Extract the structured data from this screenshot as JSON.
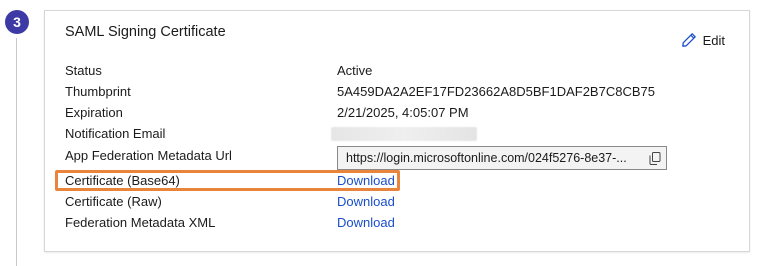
{
  "step": {
    "number": "3"
  },
  "card": {
    "title": "SAML Signing Certificate",
    "edit_label": "Edit"
  },
  "fields": [
    {
      "label": "Status",
      "value": "Active"
    },
    {
      "label": "Thumbprint",
      "value": "5A459DA2A2EF17FD23662A8D5BF1DAF2B7C8CB75"
    },
    {
      "label": "Expiration",
      "value": "2/21/2025, 4:05:07 PM"
    },
    {
      "label": "Notification Email",
      "value": ""
    },
    {
      "label": "App Federation Metadata Url",
      "value": "https://login.microsoftonline.com/024f5276-8e37-..."
    },
    {
      "label": "Certificate (Base64)",
      "value": "Download"
    },
    {
      "label": "Certificate (Raw)",
      "value": "Download"
    },
    {
      "label": "Federation Metadata XML",
      "value": "Download"
    }
  ],
  "colors": {
    "accent_link": "#1a4fc9",
    "step_circle": "#3d3aa6",
    "highlight": "#e8843c"
  },
  "icons": {
    "edit": "pencil-icon",
    "copy": "copy-icon"
  }
}
